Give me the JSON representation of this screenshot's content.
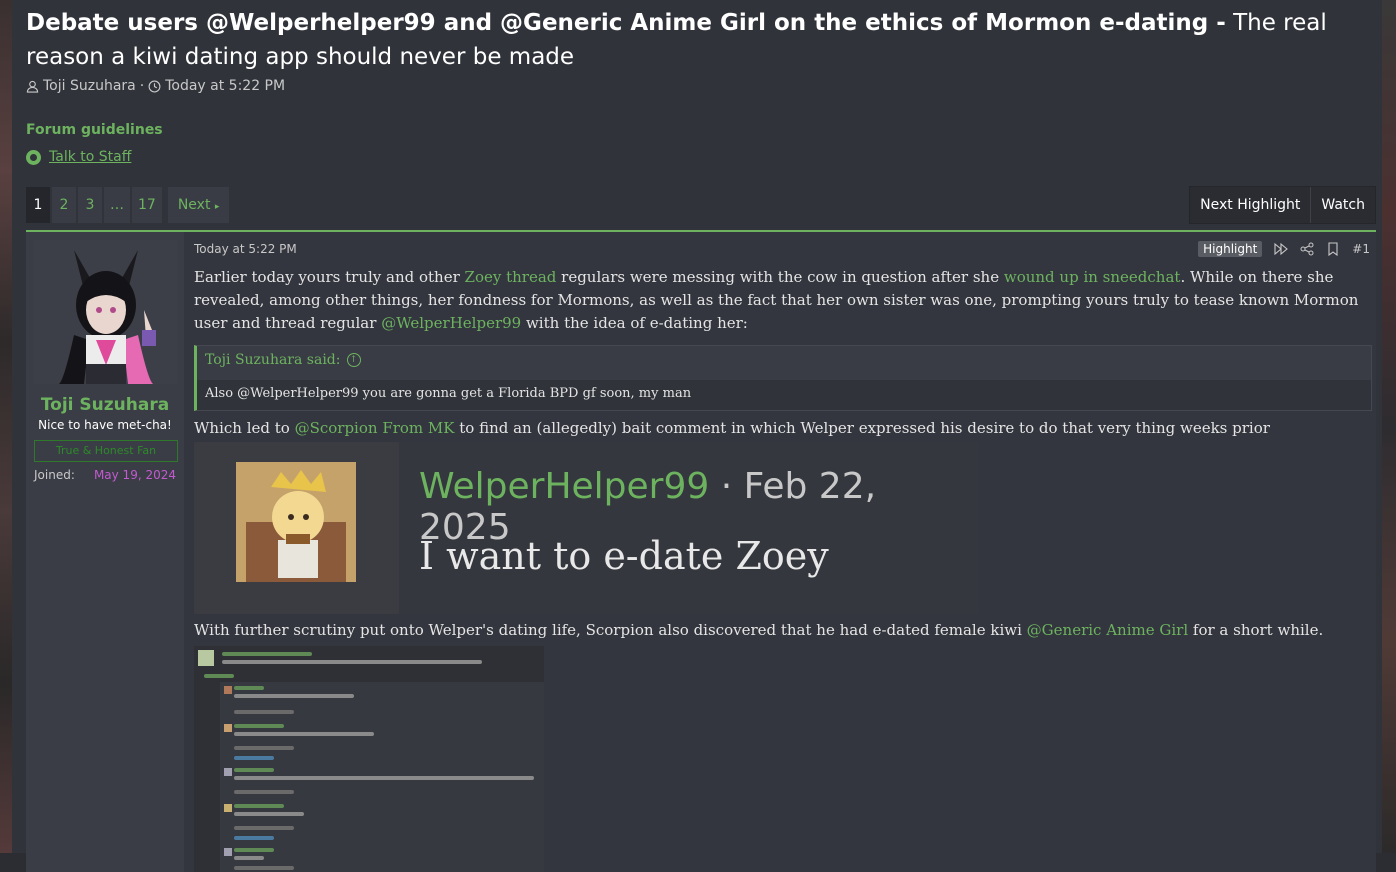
{
  "thread": {
    "prefix": "Debate users @Welperhelper99 and @Generic Anime Girl on the ethics of Mormon e-dating -",
    "title": "The real reason a kiwi dating app should never be made",
    "author": "Toji Suzuhara",
    "separator": "·",
    "time": "Today at 5:22 PM"
  },
  "guidelines": {
    "title": "Forum guidelines",
    "talk_to_staff": "Talk to Staff"
  },
  "pagination": {
    "pages": [
      "1",
      "2",
      "3",
      "…",
      "17"
    ],
    "current": "1",
    "next": "Next"
  },
  "actions": {
    "next_highlight": "Next Highlight",
    "watch": "Watch"
  },
  "post": {
    "user": {
      "name": "Toji Suzuhara",
      "title": "Nice to have met-cha!",
      "banner": "True & Honest Fan",
      "joined_label": "Joined:",
      "joined_value": "May 19, 2024"
    },
    "date": "Today at 5:22 PM",
    "highlight": "Highlight",
    "number": "#1",
    "p1": {
      "a": "Earlier today yours truly and other ",
      "link1": "Zoey thread",
      "b": " regulars were messing with the cow in question after she ",
      "link2": "wound up in sneedchat",
      "c": ". While on there she revealed, among other things, her fondness for Mormons, as well as the fact that her own sister was one, prompting yours truly to tease known Mormon user and thread regular ",
      "link3": "@WelperHelper99",
      "d": " with the idea of e-dating her:"
    },
    "quote": {
      "author": "Toji Suzuhara said:",
      "text": "Also @WelperHelper99 you are gonna get a Florida BPD gf soon, my man"
    },
    "p2": {
      "a": "Which led to ",
      "link": "@Scorpion From MK",
      "b": " to find an (allegedly) bait comment in which Welper expressed his desire to do that very thing weeks prior"
    },
    "screenshot1": {
      "name": "WelperHelper99",
      "date": " · Feb 22, 2025",
      "message": "I want to e-date Zoey"
    },
    "p3": {
      "a": "With further scrutiny put onto Welper's dating life, Scorpion also discovered that he had e-dated female kiwi ",
      "link": "@Generic Anime Girl",
      "b": " for a short while."
    }
  },
  "colors": {
    "accent": "#6db35f",
    "background": "#30333a",
    "joined_date": "#c35ad0"
  }
}
